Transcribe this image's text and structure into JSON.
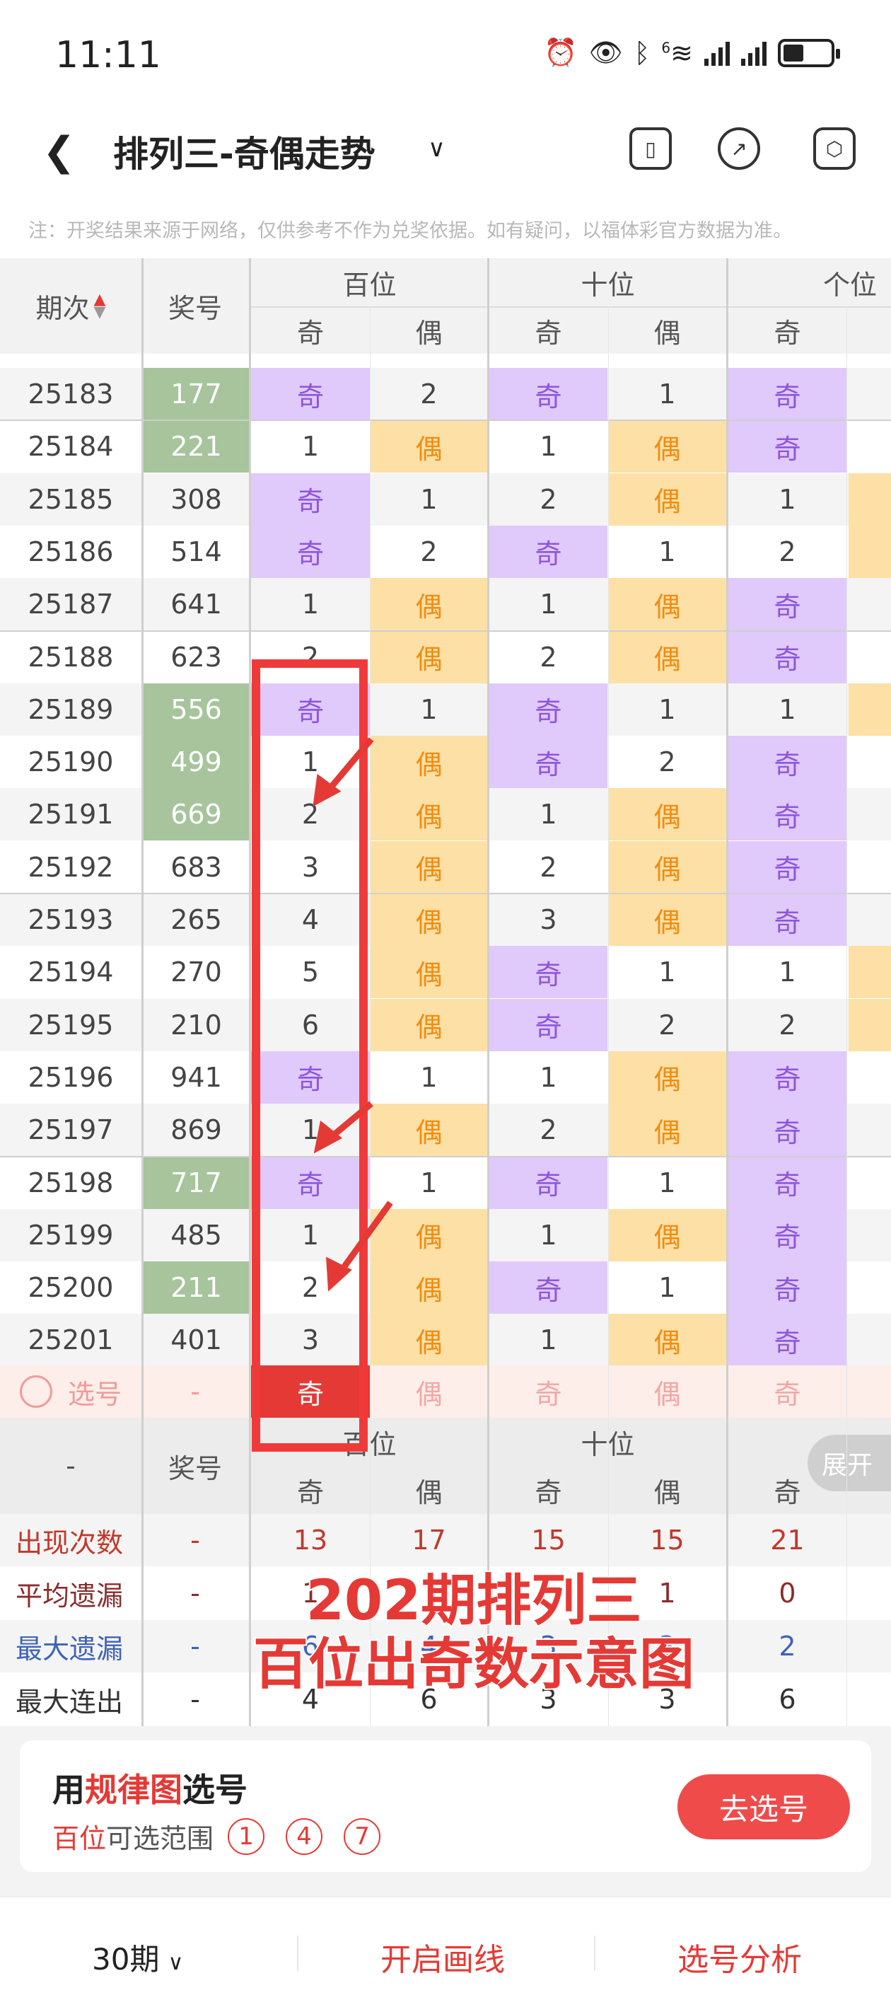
{
  "status_bar": {
    "time": "11:11",
    "signal_label": "6"
  },
  "nav": {
    "title": "排列三-奇偶走势"
  },
  "notice": "注：开奖结果来源于网络，仅供参考不作为兑奖依据。如有疑问，以福体彩官方数据为准。",
  "table_header": {
    "period": "期次",
    "prize": "奖号",
    "groups": [
      "百位",
      "十位",
      "个位"
    ],
    "sub": [
      "奇",
      "偶",
      "奇",
      "偶",
      "奇"
    ]
  },
  "rows": [
    {
      "period": "25183",
      "prize": "177",
      "green": true,
      "cells": [
        "奇",
        "2",
        "奇",
        "1",
        "奇"
      ]
    },
    {
      "period": "25184",
      "prize": "221",
      "green": true,
      "cells": [
        "1",
        "偶",
        "1",
        "偶",
        "奇"
      ]
    },
    {
      "period": "25185",
      "prize": "308",
      "green": false,
      "cells": [
        "奇",
        "1",
        "2",
        "偶",
        "1"
      ]
    },
    {
      "period": "25186",
      "prize": "514",
      "green": false,
      "cells": [
        "奇",
        "2",
        "奇",
        "1",
        "2"
      ]
    },
    {
      "period": "25187",
      "prize": "641",
      "green": false,
      "cells": [
        "1",
        "偶",
        "1",
        "偶",
        "奇"
      ]
    },
    {
      "period": "25188",
      "prize": "623",
      "green": false,
      "cells": [
        "2",
        "偶",
        "2",
        "偶",
        "奇"
      ]
    },
    {
      "period": "25189",
      "prize": "556",
      "green": true,
      "cells": [
        "奇",
        "1",
        "奇",
        "1",
        "1"
      ]
    },
    {
      "period": "25190",
      "prize": "499",
      "green": true,
      "cells": [
        "1",
        "偶",
        "奇",
        "2",
        "奇"
      ]
    },
    {
      "period": "25191",
      "prize": "669",
      "green": true,
      "cells": [
        "2",
        "偶",
        "1",
        "偶",
        "奇"
      ]
    },
    {
      "period": "25192",
      "prize": "683",
      "green": false,
      "cells": [
        "3",
        "偶",
        "2",
        "偶",
        "奇"
      ]
    },
    {
      "period": "25193",
      "prize": "265",
      "green": false,
      "cells": [
        "4",
        "偶",
        "3",
        "偶",
        "奇"
      ]
    },
    {
      "period": "25194",
      "prize": "270",
      "green": false,
      "cells": [
        "5",
        "偶",
        "奇",
        "1",
        "1"
      ]
    },
    {
      "period": "25195",
      "prize": "210",
      "green": false,
      "cells": [
        "6",
        "偶",
        "奇",
        "2",
        "2"
      ]
    },
    {
      "period": "25196",
      "prize": "941",
      "green": false,
      "cells": [
        "奇",
        "1",
        "1",
        "偶",
        "奇"
      ]
    },
    {
      "period": "25197",
      "prize": "869",
      "green": false,
      "cells": [
        "1",
        "偶",
        "2",
        "偶",
        "奇"
      ]
    },
    {
      "period": "25198",
      "prize": "717",
      "green": true,
      "cells": [
        "奇",
        "1",
        "奇",
        "1",
        "奇"
      ]
    },
    {
      "period": "25199",
      "prize": "485",
      "green": false,
      "cells": [
        "1",
        "偶",
        "1",
        "偶",
        "奇"
      ]
    },
    {
      "period": "25200",
      "prize": "211",
      "green": true,
      "cells": [
        "2",
        "偶",
        "奇",
        "1",
        "奇"
      ]
    },
    {
      "period": "25201",
      "prize": "401",
      "green": false,
      "cells": [
        "3",
        "偶",
        "1",
        "偶",
        "奇"
      ]
    }
  ],
  "select_row": {
    "label": "选号",
    "prize": "-",
    "cells": [
      "奇",
      "偶",
      "奇",
      "偶",
      "奇"
    ]
  },
  "footer_header": {
    "dash": "-",
    "prize": "奖号",
    "groups": [
      "百位",
      "十位"
    ],
    "sub": [
      "奇",
      "偶",
      "奇",
      "偶",
      "奇"
    ],
    "expand": "展开"
  },
  "stats": [
    {
      "label": "出现次数",
      "dash": "-",
      "vals": [
        "13",
        "17",
        "15",
        "15",
        "21"
      ]
    },
    {
      "label": "平均遗漏",
      "dash": "-",
      "vals": [
        "1",
        "",
        "",
        "1",
        "0"
      ]
    },
    {
      "label": "最大遗漏",
      "dash": "-",
      "vals": [
        "6",
        "4",
        "3",
        "3",
        "2"
      ]
    },
    {
      "label": "最大连出",
      "dash": "-",
      "vals": [
        "4",
        "6",
        "3",
        "3",
        "6"
      ]
    }
  ],
  "overlay": {
    "line1": "202期排列三",
    "line2": "百位出奇数示意图"
  },
  "card": {
    "prefix": "用",
    "highlight": "规律图",
    "suffix": "选号",
    "range_label": "百位",
    "range_text": "可选范围",
    "nums": [
      "1",
      "4",
      "7"
    ],
    "button": "去选号"
  },
  "bottom": {
    "periods": "30期",
    "draw": "开启画线",
    "analysis": "选号分析"
  },
  "colors": {
    "accent": "#e53935",
    "purple": "#e0c9fb",
    "orange": "#fde0a6",
    "green": "#a7c49d"
  }
}
